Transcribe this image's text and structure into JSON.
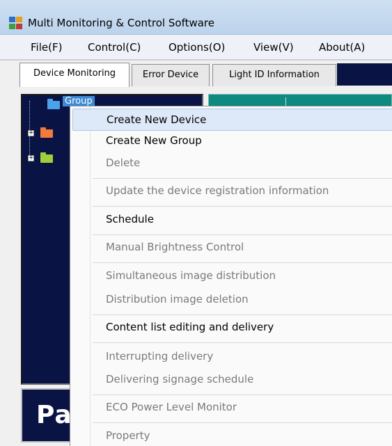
{
  "window": {
    "title": "Multi Monitoring & Control Software"
  },
  "menubar": {
    "items": [
      "File(F)",
      "Control(C)",
      "Options(O)",
      "View(V)",
      "About(A)"
    ]
  },
  "tabs": [
    "Device Monitoring",
    "Error Device",
    "Light ID Information"
  ],
  "tree": {
    "root_label": "Group"
  },
  "logo": {
    "text": "Pa"
  },
  "context_menu": {
    "items": [
      {
        "label": "Create New Device",
        "enabled": true,
        "highlighted": true
      },
      {
        "label": "Create New Group",
        "enabled": true
      },
      {
        "label": "Delete",
        "enabled": false
      },
      {
        "label": "Update the device registration information",
        "enabled": false
      },
      {
        "label": "Schedule",
        "enabled": true
      },
      {
        "label": "Manual Brightness Control",
        "enabled": false
      },
      {
        "label": "Simultaneous image distribution",
        "enabled": false
      },
      {
        "label": "Distribution image deletion",
        "enabled": false
      },
      {
        "label": "Content list editing and delivery",
        "enabled": true
      },
      {
        "label": "Interrupting delivery",
        "enabled": false
      },
      {
        "label": "Delivering signage schedule",
        "enabled": false
      },
      {
        "label": "ECO Power Level Monitor",
        "enabled": false
      },
      {
        "label": "Property",
        "enabled": false
      }
    ]
  },
  "colors": {
    "tree_background": "#0a1444",
    "teal_header": "#0e8a80",
    "menu_highlight": "#dde9f8",
    "disabled_text": "#7a7a7a"
  }
}
